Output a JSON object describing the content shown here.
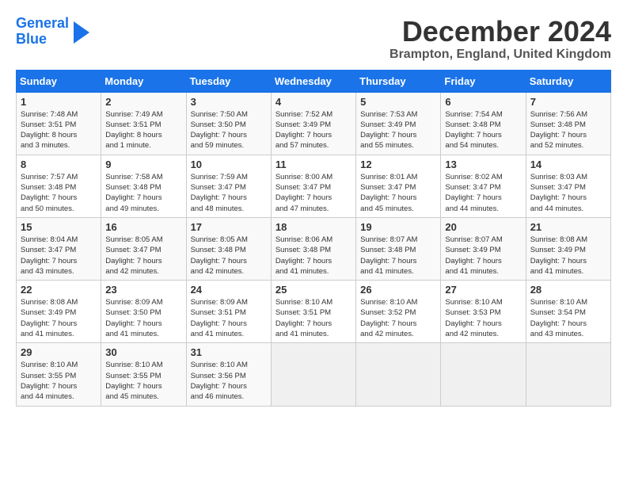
{
  "header": {
    "logo_line1": "General",
    "logo_line2": "Blue",
    "month_title": "December 2024",
    "location": "Brampton, England, United Kingdom"
  },
  "weekdays": [
    "Sunday",
    "Monday",
    "Tuesday",
    "Wednesday",
    "Thursday",
    "Friday",
    "Saturday"
  ],
  "weeks": [
    [
      {
        "day": "1",
        "info": "Sunrise: 7:48 AM\nSunset: 3:51 PM\nDaylight: 8 hours\nand 3 minutes."
      },
      {
        "day": "2",
        "info": "Sunrise: 7:49 AM\nSunset: 3:51 PM\nDaylight: 8 hours\nand 1 minute."
      },
      {
        "day": "3",
        "info": "Sunrise: 7:50 AM\nSunset: 3:50 PM\nDaylight: 7 hours\nand 59 minutes."
      },
      {
        "day": "4",
        "info": "Sunrise: 7:52 AM\nSunset: 3:49 PM\nDaylight: 7 hours\nand 57 minutes."
      },
      {
        "day": "5",
        "info": "Sunrise: 7:53 AM\nSunset: 3:49 PM\nDaylight: 7 hours\nand 55 minutes."
      },
      {
        "day": "6",
        "info": "Sunrise: 7:54 AM\nSunset: 3:48 PM\nDaylight: 7 hours\nand 54 minutes."
      },
      {
        "day": "7",
        "info": "Sunrise: 7:56 AM\nSunset: 3:48 PM\nDaylight: 7 hours\nand 52 minutes."
      }
    ],
    [
      {
        "day": "8",
        "info": "Sunrise: 7:57 AM\nSunset: 3:48 PM\nDaylight: 7 hours\nand 50 minutes."
      },
      {
        "day": "9",
        "info": "Sunrise: 7:58 AM\nSunset: 3:48 PM\nDaylight: 7 hours\nand 49 minutes."
      },
      {
        "day": "10",
        "info": "Sunrise: 7:59 AM\nSunset: 3:47 PM\nDaylight: 7 hours\nand 48 minutes."
      },
      {
        "day": "11",
        "info": "Sunrise: 8:00 AM\nSunset: 3:47 PM\nDaylight: 7 hours\nand 47 minutes."
      },
      {
        "day": "12",
        "info": "Sunrise: 8:01 AM\nSunset: 3:47 PM\nDaylight: 7 hours\nand 45 minutes."
      },
      {
        "day": "13",
        "info": "Sunrise: 8:02 AM\nSunset: 3:47 PM\nDaylight: 7 hours\nand 44 minutes."
      },
      {
        "day": "14",
        "info": "Sunrise: 8:03 AM\nSunset: 3:47 PM\nDaylight: 7 hours\nand 44 minutes."
      }
    ],
    [
      {
        "day": "15",
        "info": "Sunrise: 8:04 AM\nSunset: 3:47 PM\nDaylight: 7 hours\nand 43 minutes."
      },
      {
        "day": "16",
        "info": "Sunrise: 8:05 AM\nSunset: 3:47 PM\nDaylight: 7 hours\nand 42 minutes."
      },
      {
        "day": "17",
        "info": "Sunrise: 8:05 AM\nSunset: 3:48 PM\nDaylight: 7 hours\nand 42 minutes."
      },
      {
        "day": "18",
        "info": "Sunrise: 8:06 AM\nSunset: 3:48 PM\nDaylight: 7 hours\nand 41 minutes."
      },
      {
        "day": "19",
        "info": "Sunrise: 8:07 AM\nSunset: 3:48 PM\nDaylight: 7 hours\nand 41 minutes."
      },
      {
        "day": "20",
        "info": "Sunrise: 8:07 AM\nSunset: 3:49 PM\nDaylight: 7 hours\nand 41 minutes."
      },
      {
        "day": "21",
        "info": "Sunrise: 8:08 AM\nSunset: 3:49 PM\nDaylight: 7 hours\nand 41 minutes."
      }
    ],
    [
      {
        "day": "22",
        "info": "Sunrise: 8:08 AM\nSunset: 3:49 PM\nDaylight: 7 hours\nand 41 minutes."
      },
      {
        "day": "23",
        "info": "Sunrise: 8:09 AM\nSunset: 3:50 PM\nDaylight: 7 hours\nand 41 minutes."
      },
      {
        "day": "24",
        "info": "Sunrise: 8:09 AM\nSunset: 3:51 PM\nDaylight: 7 hours\nand 41 minutes."
      },
      {
        "day": "25",
        "info": "Sunrise: 8:10 AM\nSunset: 3:51 PM\nDaylight: 7 hours\nand 41 minutes."
      },
      {
        "day": "26",
        "info": "Sunrise: 8:10 AM\nSunset: 3:52 PM\nDaylight: 7 hours\nand 42 minutes."
      },
      {
        "day": "27",
        "info": "Sunrise: 8:10 AM\nSunset: 3:53 PM\nDaylight: 7 hours\nand 42 minutes."
      },
      {
        "day": "28",
        "info": "Sunrise: 8:10 AM\nSunset: 3:54 PM\nDaylight: 7 hours\nand 43 minutes."
      }
    ],
    [
      {
        "day": "29",
        "info": "Sunrise: 8:10 AM\nSunset: 3:55 PM\nDaylight: 7 hours\nand 44 minutes."
      },
      {
        "day": "30",
        "info": "Sunrise: 8:10 AM\nSunset: 3:55 PM\nDaylight: 7 hours\nand 45 minutes."
      },
      {
        "day": "31",
        "info": "Sunrise: 8:10 AM\nSunset: 3:56 PM\nDaylight: 7 hours\nand 46 minutes."
      },
      {
        "day": "",
        "info": ""
      },
      {
        "day": "",
        "info": ""
      },
      {
        "day": "",
        "info": ""
      },
      {
        "day": "",
        "info": ""
      }
    ]
  ]
}
